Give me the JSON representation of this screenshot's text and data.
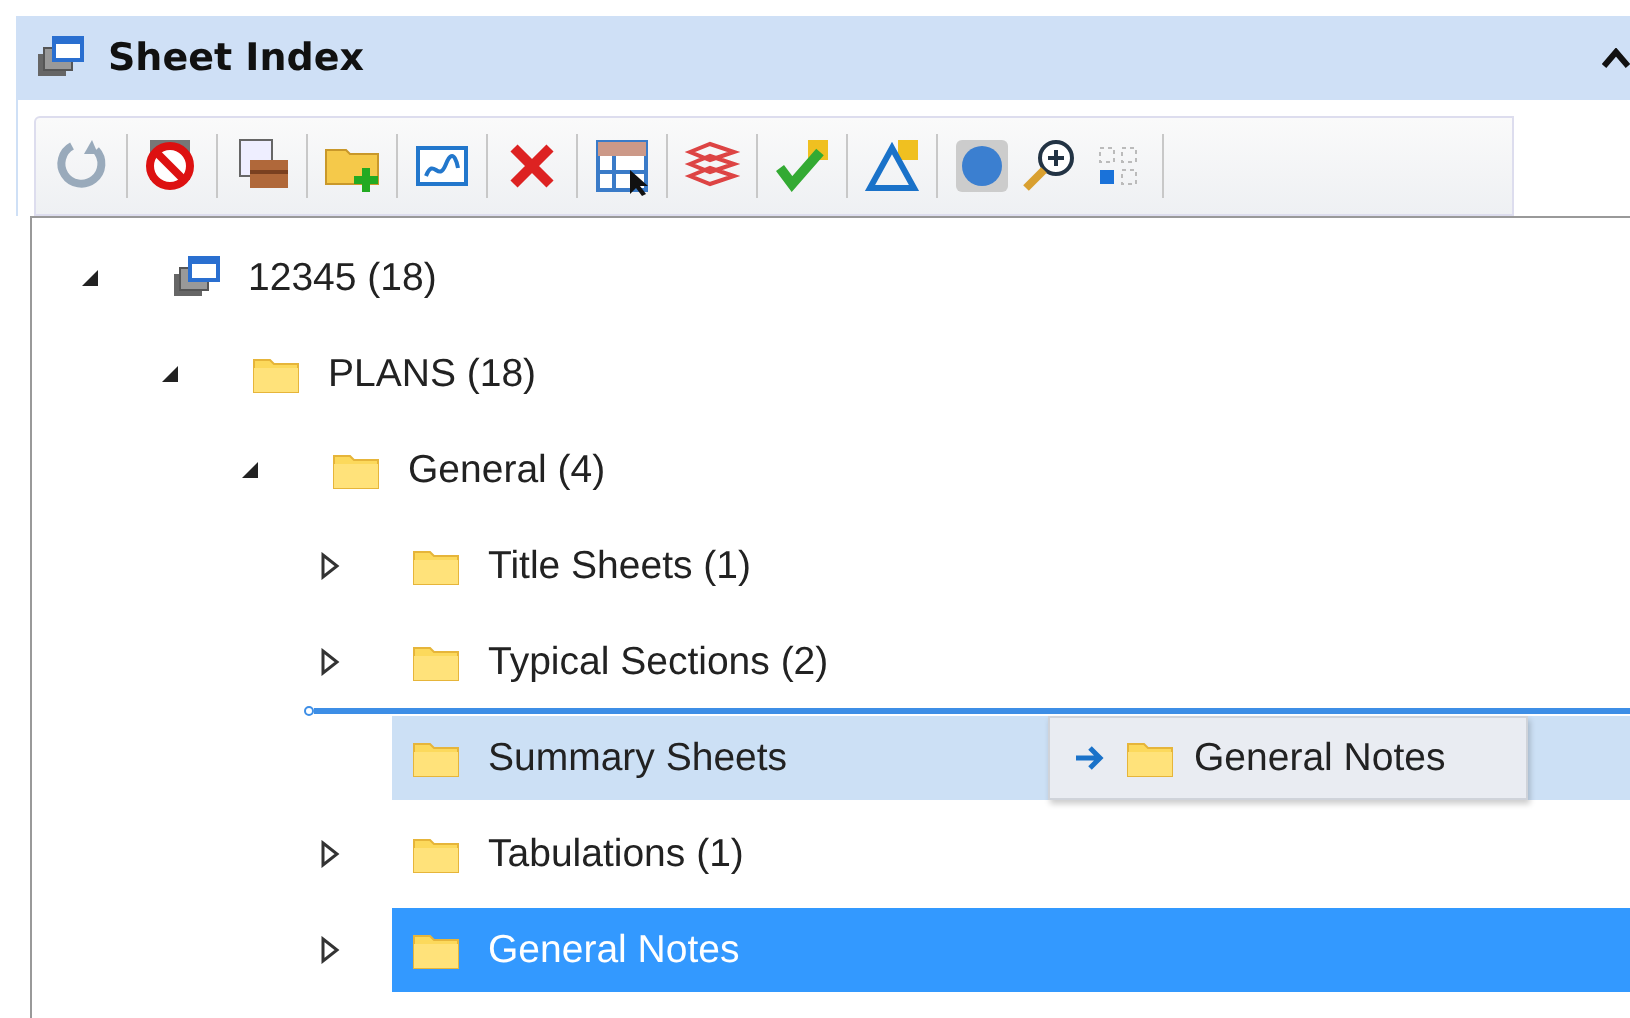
{
  "panel": {
    "title": "Sheet Index"
  },
  "tree": [
    {
      "label": "12345 (18)",
      "kind": "project",
      "expanded": true,
      "leaf": false,
      "selected": false,
      "drop_target": false,
      "children": [
        {
          "label": "PLANS (18)",
          "kind": "folder",
          "expanded": true,
          "leaf": false,
          "selected": false,
          "drop_target": false,
          "children": [
            {
              "label": "General (4)",
              "kind": "folder",
              "expanded": true,
              "leaf": false,
              "selected": false,
              "drop_target": false,
              "children": [
                {
                  "label": "Title Sheets (1)",
                  "kind": "folder",
                  "expanded": false,
                  "leaf": false,
                  "selected": false,
                  "drop_target": false
                },
                {
                  "label": "Typical Sections (2)",
                  "kind": "folder",
                  "expanded": false,
                  "leaf": false,
                  "selected": false,
                  "drop_target": false
                },
                {
                  "label": "Summary Sheets",
                  "kind": "folder",
                  "expanded": false,
                  "leaf": true,
                  "selected": false,
                  "drop_target": true
                },
                {
                  "label": "Tabulations (1)",
                  "kind": "folder",
                  "expanded": false,
                  "leaf": false,
                  "selected": false,
                  "drop_target": false
                },
                {
                  "label": "General Notes",
                  "kind": "folder",
                  "expanded": false,
                  "leaf": false,
                  "selected": true,
                  "drop_target": false
                }
              ]
            }
          ]
        }
      ]
    }
  ],
  "drag": {
    "label": "General Notes"
  }
}
